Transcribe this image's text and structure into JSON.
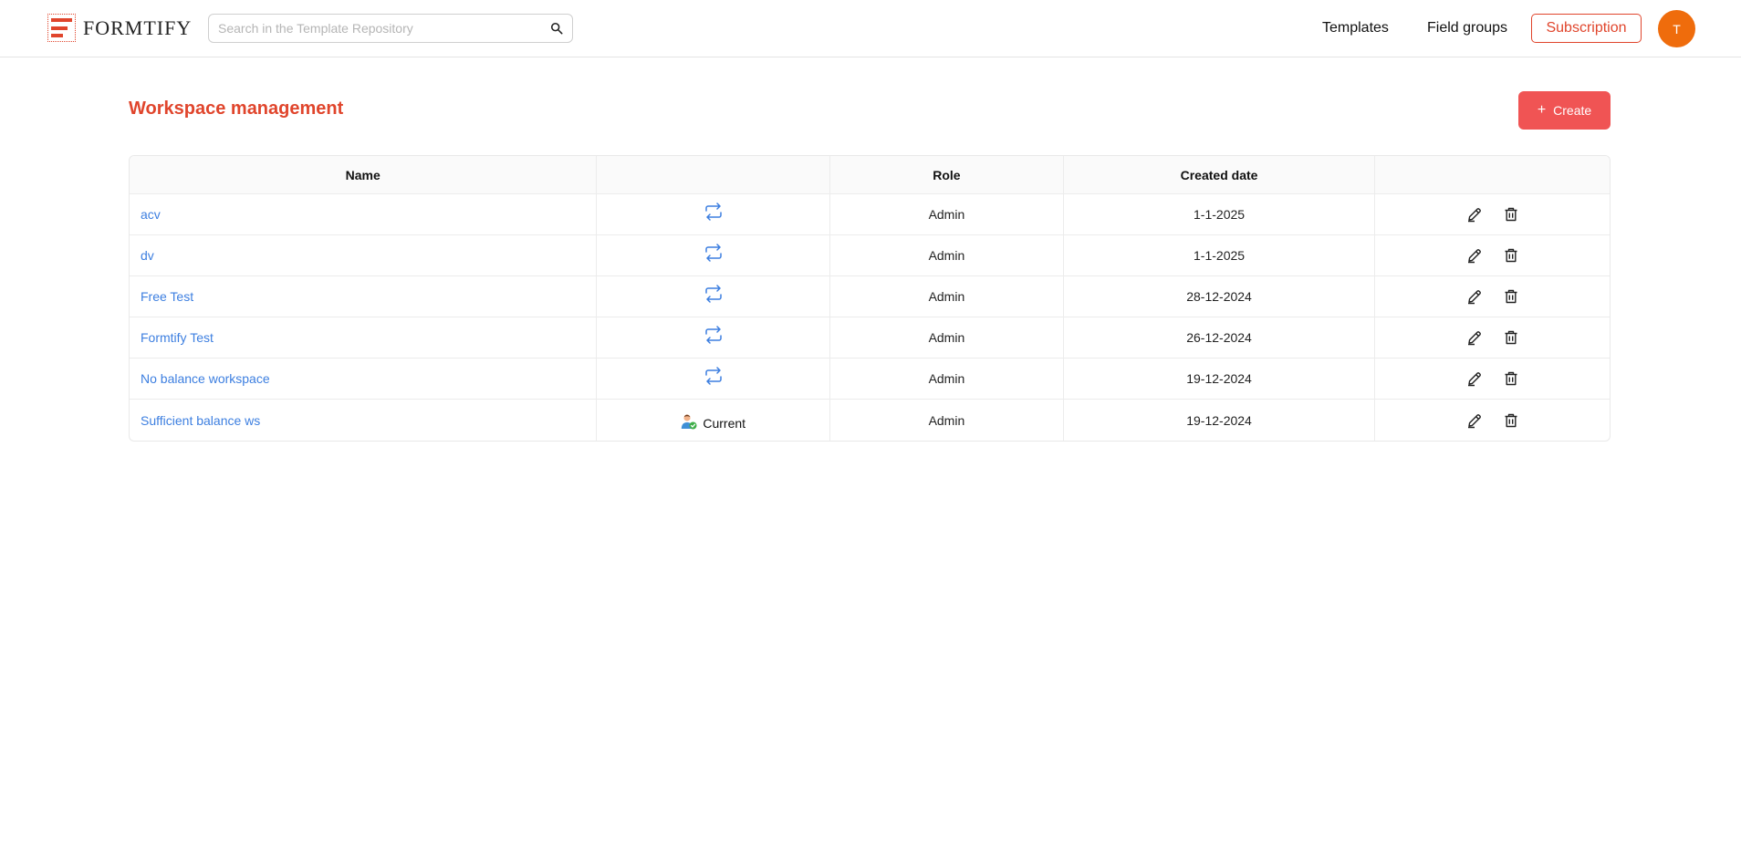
{
  "header": {
    "logo_text": "FORMTIFY",
    "search_placeholder": "Search in the Template Repository",
    "nav": {
      "templates": "Templates",
      "field_groups": "Field groups"
    },
    "subscription_label": "Subscription",
    "avatar_initial": "T"
  },
  "page": {
    "title": "Workspace management",
    "create_label": "Create"
  },
  "table": {
    "columns": [
      "Name",
      "",
      "Role",
      "Created date",
      ""
    ],
    "rows": [
      {
        "name": "acv",
        "role": "Admin",
        "created": "1-1-2025",
        "current": false
      },
      {
        "name": "dv",
        "role": "Admin",
        "created": "1-1-2025",
        "current": false
      },
      {
        "name": "Free Test",
        "role": "Admin",
        "created": "28-12-2024",
        "current": false
      },
      {
        "name": "Formtify Test",
        "role": "Admin",
        "created": "26-12-2024",
        "current": false
      },
      {
        "name": "No balance workspace",
        "role": "Admin",
        "created": "19-12-2024",
        "current": false
      },
      {
        "name": "Sufficient balance ws",
        "role": "Admin",
        "created": "19-12-2024",
        "current": true,
        "current_label": "Current"
      }
    ]
  },
  "colors": {
    "brand": "#e0452c",
    "create_button": "#f05454",
    "link": "#3d7fe0",
    "avatar": "#ef6c0c"
  }
}
